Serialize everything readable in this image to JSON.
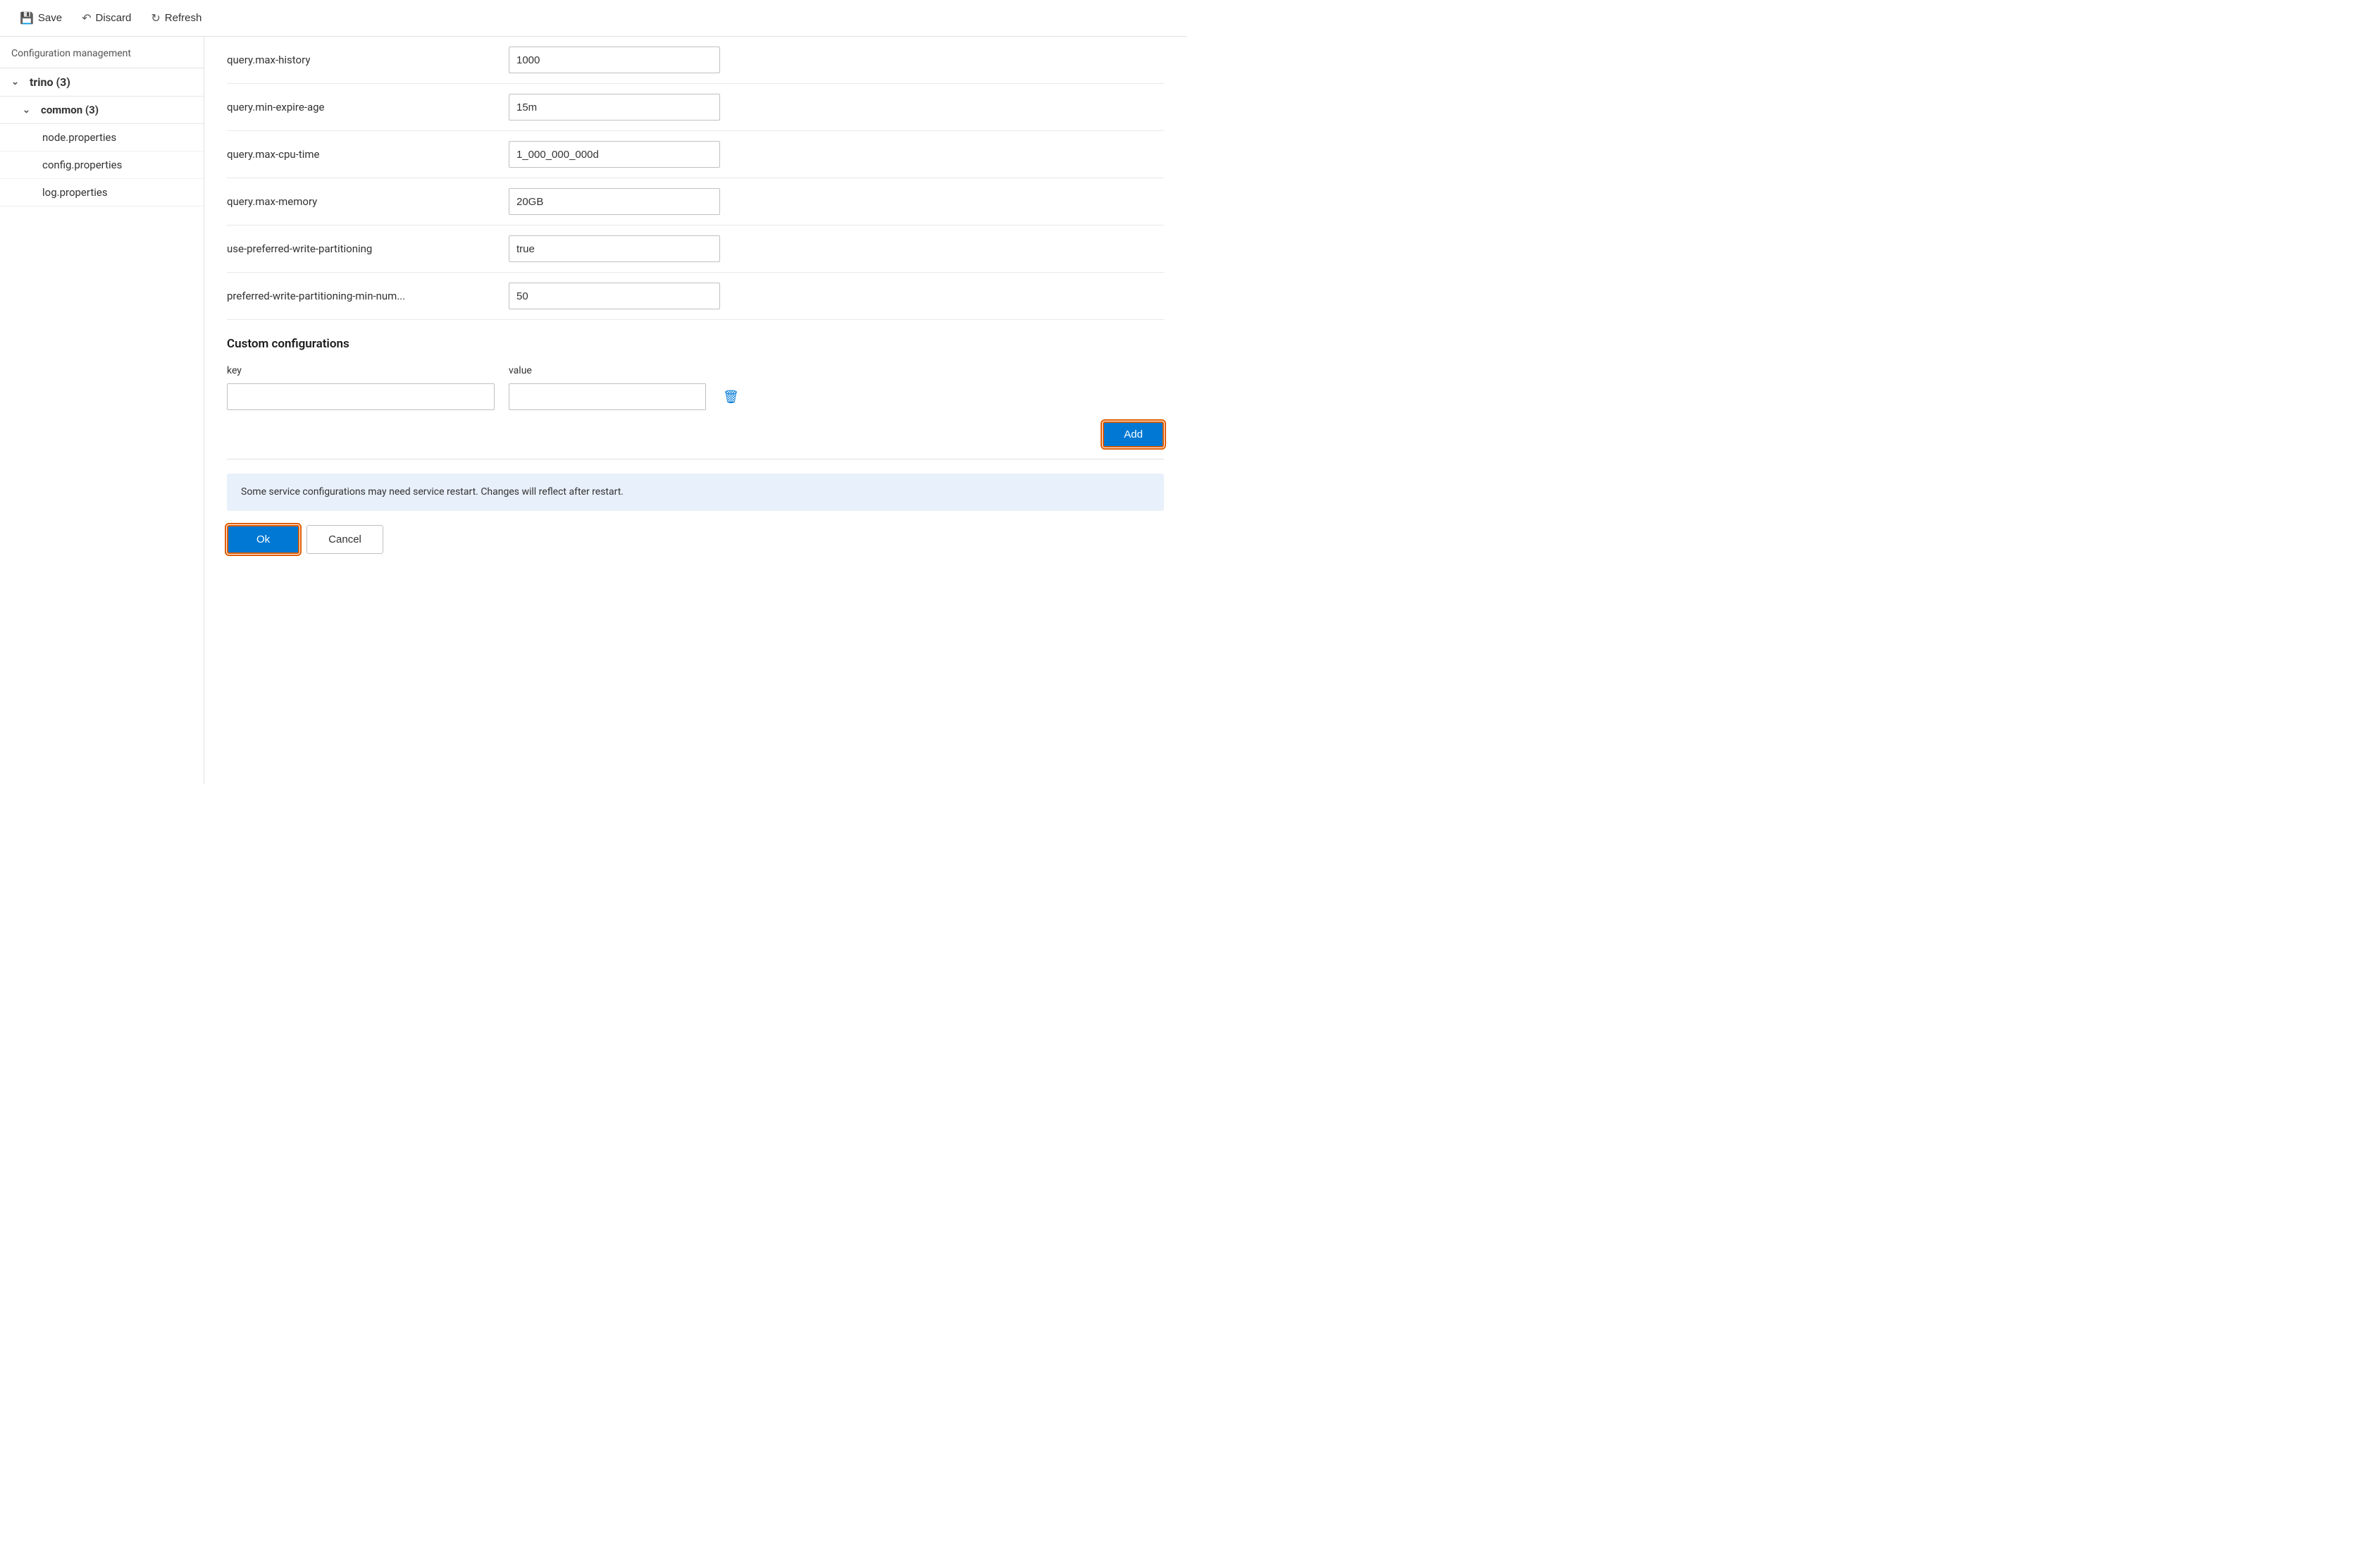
{
  "toolbar": {
    "save_label": "Save",
    "discard_label": "Discard",
    "refresh_label": "Refresh"
  },
  "sidebar": {
    "title": "Configuration management",
    "tree": {
      "root_label": "trino (3)",
      "child_label": "common (3)",
      "files": [
        {
          "name": "node.properties"
        },
        {
          "name": "config.properties"
        },
        {
          "name": "log.properties"
        }
      ]
    }
  },
  "config_rows": [
    {
      "label": "query.max-history",
      "value": "1000"
    },
    {
      "label": "query.min-expire-age",
      "value": "15m"
    },
    {
      "label": "query.max-cpu-time",
      "value": "1_000_000_000d"
    },
    {
      "label": "query.max-memory",
      "value": "20GB"
    },
    {
      "label": "use-preferred-write-partitioning",
      "value": "true"
    },
    {
      "label": "preferred-write-partitioning-min-num...",
      "value": "50"
    }
  ],
  "custom_section": {
    "title": "Custom configurations",
    "key_header": "key",
    "value_header": "value",
    "key_placeholder": "",
    "value_placeholder": ""
  },
  "add_button": {
    "label": "Add"
  },
  "info_banner": {
    "text": "Some service configurations may need service restart. Changes will reflect after restart."
  },
  "bottom_buttons": {
    "ok_label": "Ok",
    "cancel_label": "Cancel"
  }
}
